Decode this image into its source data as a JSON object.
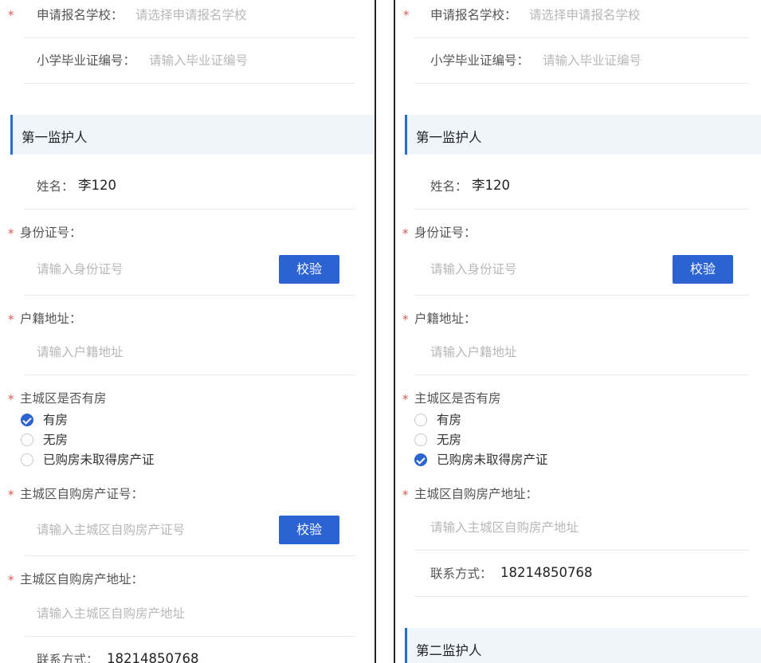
{
  "left": {
    "school": {
      "label": "申请报名学校：",
      "placeholder": "请选择申请报名学校"
    },
    "cert": {
      "label": "小学毕业证编号：",
      "placeholder": "请输入毕业证编号"
    },
    "section_title": "第一监护人",
    "name": {
      "label": "姓名：",
      "value": "李120"
    },
    "idcard": {
      "label": "身份证号：",
      "placeholder": "请输入身份证号",
      "button": "校验"
    },
    "hukou": {
      "label": "户籍地址：",
      "placeholder": "请输入户籍地址"
    },
    "house": {
      "label": "主城区是否有房",
      "options": [
        {
          "label": "有房",
          "checked": true
        },
        {
          "label": "无房",
          "checked": false
        },
        {
          "label": "已购房未取得房产证",
          "checked": false
        }
      ]
    },
    "house_cert": {
      "label": "主城区自购房产证号：",
      "placeholder": "请输入主城区自购房产证号",
      "button": "校验"
    },
    "house_addr": {
      "label": "主城区自购房产地址：",
      "placeholder": "请输入主城区自购房产地址"
    },
    "contact": {
      "label": "联系方式：",
      "value": "18214850768"
    }
  },
  "right": {
    "school": {
      "label": "申请报名学校：",
      "placeholder": "请选择申请报名学校"
    },
    "cert": {
      "label": "小学毕业证编号：",
      "placeholder": "请输入毕业证编号"
    },
    "section_title": "第一监护人",
    "name": {
      "label": "姓名：",
      "value": "李120"
    },
    "idcard": {
      "label": "身份证号：",
      "placeholder": "请输入身份证号",
      "button": "校验"
    },
    "hukou": {
      "label": "户籍地址：",
      "placeholder": "请输入户籍地址"
    },
    "house": {
      "label": "主城区是否有房",
      "options": [
        {
          "label": "有房",
          "checked": false
        },
        {
          "label": "无房",
          "checked": false
        },
        {
          "label": "已购房未取得房产证",
          "checked": true
        }
      ]
    },
    "house_addr": {
      "label": "主城区自购房产地址：",
      "placeholder": "请输入主城区自购房产地址"
    },
    "contact": {
      "label": "联系方式：",
      "value": "18214850768"
    },
    "section2_title": "第二监护人"
  },
  "colors": {
    "accent": "#2b63d2",
    "required": "#e25b52",
    "section_bg": "#f0f5fb"
  }
}
